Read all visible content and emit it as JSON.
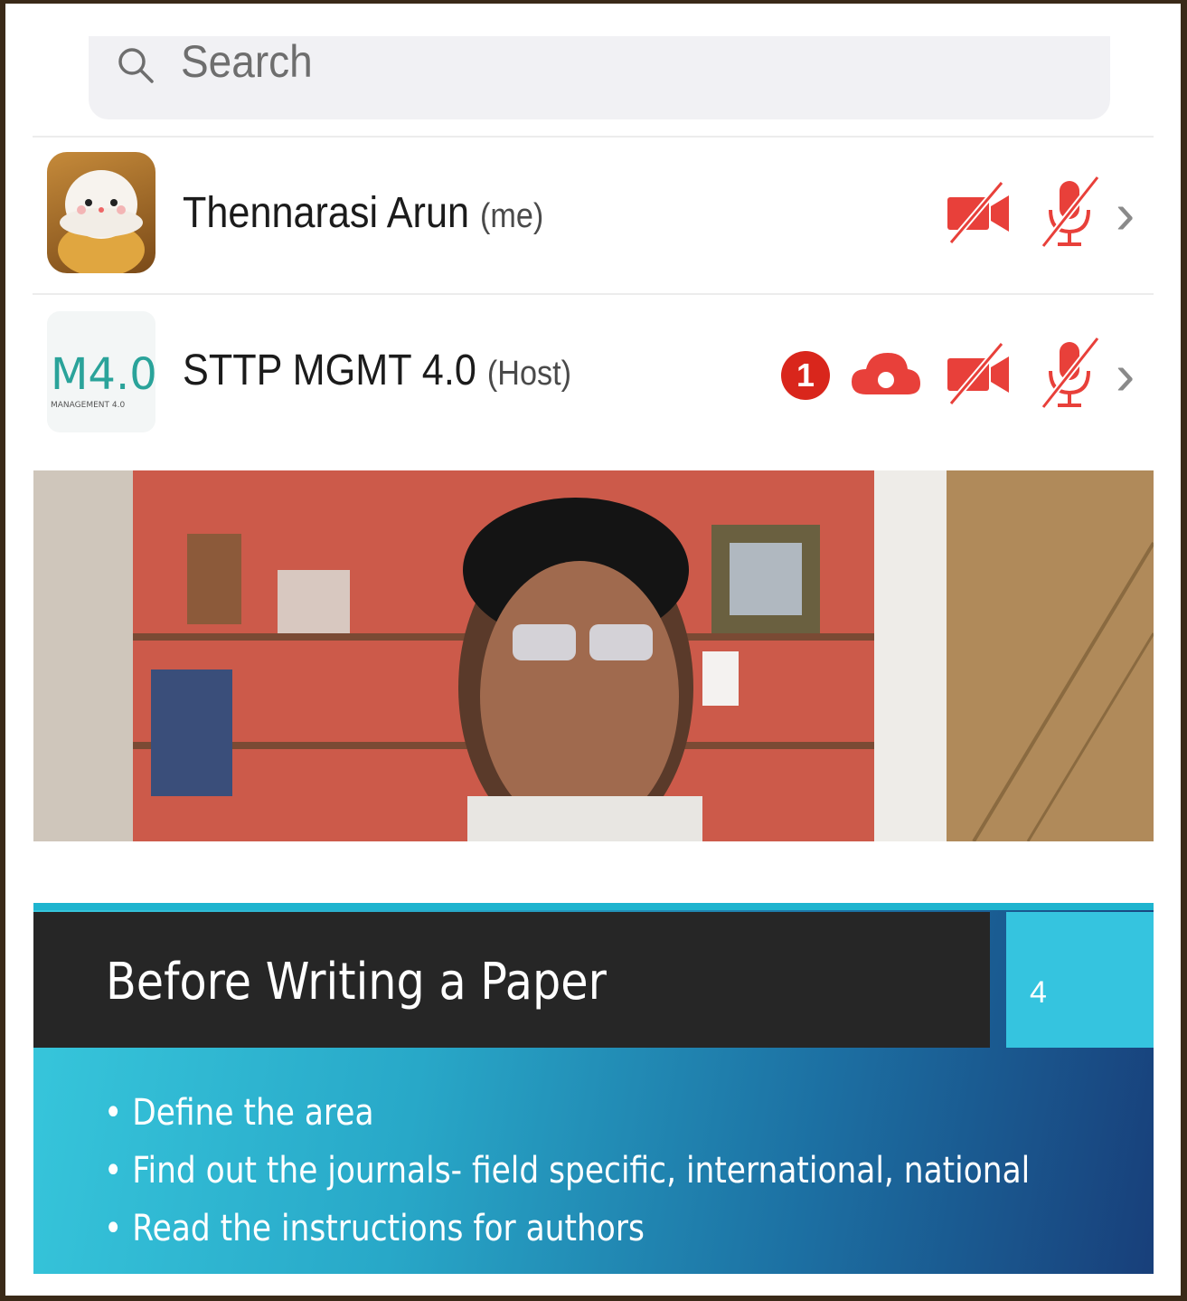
{
  "search": {
    "placeholder": "Search",
    "icon": "search-icon"
  },
  "participants": [
    {
      "name": "Thennarasi Arun",
      "role": "(me)",
      "avatar": "cat-avatar",
      "video_status": "off",
      "audio_status": "muted"
    },
    {
      "name": "STTP MGMT 4.0",
      "role": "(Host)",
      "avatar": "logo-avatar",
      "avatar_logo_text": "M4.0",
      "avatar_logo_subtext": "MANAGEMENT 4.0",
      "badge_count": "1",
      "recording": "cloud",
      "video_status": "off",
      "audio_status": "muted"
    }
  ],
  "slide": {
    "title": "Before Writing a Paper",
    "page_number": "4",
    "bullets": [
      "Define the area",
      "Find out the journals- field specific, international, national",
      "Read the instructions for authors"
    ]
  },
  "colors": {
    "muted_red": "#e8403a",
    "badge_red": "#d9261c",
    "slide_title_band": "#262626",
    "slide_accent": "#35c4df"
  }
}
